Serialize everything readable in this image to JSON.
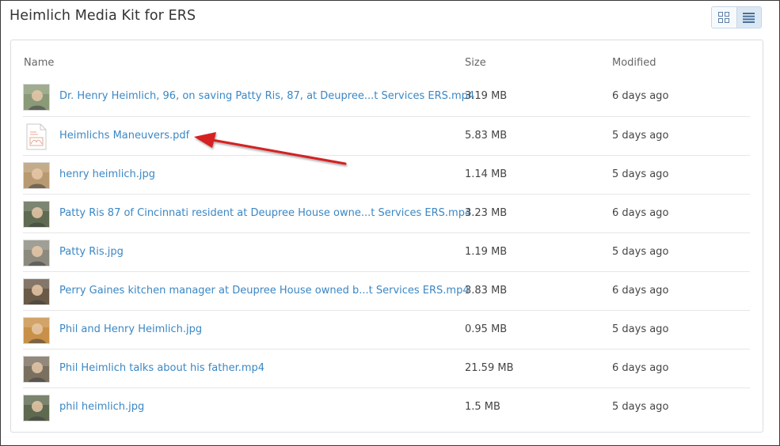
{
  "page": {
    "title": "Heimlich Media Kit for ERS"
  },
  "view_toggle": {
    "grid_icon": "grid-icon",
    "list_icon": "list-icon",
    "active": "list"
  },
  "columns": {
    "name": "Name",
    "size": "Size",
    "modified": "Modified"
  },
  "files": [
    {
      "name": "Dr. Henry Heimlich, 96, on saving Patty Ris, 87, at Deupree...t Services ERS.mp4",
      "size": "3.19 MB",
      "modified": "6 days ago",
      "kind": "video",
      "thumb_color": "#8a9a78"
    },
    {
      "name": "Heimlichs Maneuvers.pdf",
      "size": "5.83 MB",
      "modified": "5 days ago",
      "kind": "pdf",
      "thumb_color": "#e8a896"
    },
    {
      "name": "henry heimlich.jpg",
      "size": "1.14 MB",
      "modified": "5 days ago",
      "kind": "image",
      "thumb_color": "#b89a72"
    },
    {
      "name": "Patty Ris 87 of Cincinnati resident at Deupree House owne...t Services ERS.mp4",
      "size": "3.23 MB",
      "modified": "6 days ago",
      "kind": "video",
      "thumb_color": "#5f6b52"
    },
    {
      "name": "Patty Ris.jpg",
      "size": "1.19 MB",
      "modified": "5 days ago",
      "kind": "image",
      "thumb_color": "#8c8a7e"
    },
    {
      "name": "Perry Gaines kitchen manager at Deupree House owned b...t Services ERS.mp4",
      "size": "3.83 MB",
      "modified": "6 days ago",
      "kind": "video",
      "thumb_color": "#6a5a48"
    },
    {
      "name": "Phil and Henry Heimlich.jpg",
      "size": "0.95 MB",
      "modified": "5 days ago",
      "kind": "image",
      "thumb_color": "#c89048"
    },
    {
      "name": "Phil Heimlich talks about his father.mp4",
      "size": "21.59 MB",
      "modified": "6 days ago",
      "kind": "video",
      "thumb_color": "#7a7060"
    },
    {
      "name": "phil heimlich.jpg",
      "size": "1.5 MB",
      "modified": "5 days ago",
      "kind": "image",
      "thumb_color": "#5e6a50"
    }
  ],
  "annotation": {
    "arrow_color": "#d42020"
  }
}
